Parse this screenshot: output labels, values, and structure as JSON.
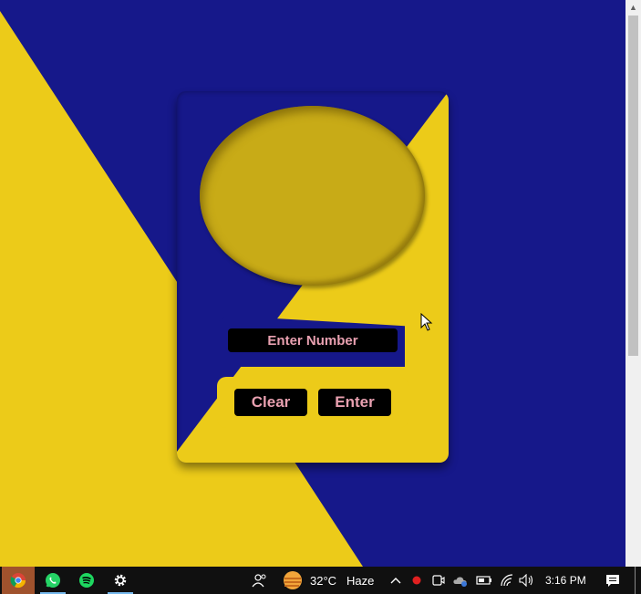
{
  "card": {
    "input_placeholder": "Enter Number",
    "clear_label": "Clear",
    "enter_label": "Enter"
  },
  "colors": {
    "blue": "#16188a",
    "yellow": "#eccb19",
    "display": "#c8ab17",
    "button_bg": "#000000",
    "button_text": "#e8a0b0"
  },
  "taskbar": {
    "apps": [
      "chrome-icon",
      "whatsapp-icon",
      "spotify-icon",
      "settings-icon"
    ],
    "weather_temp": "32°C",
    "weather_condition": "Haze",
    "clock": "3:16 PM"
  }
}
